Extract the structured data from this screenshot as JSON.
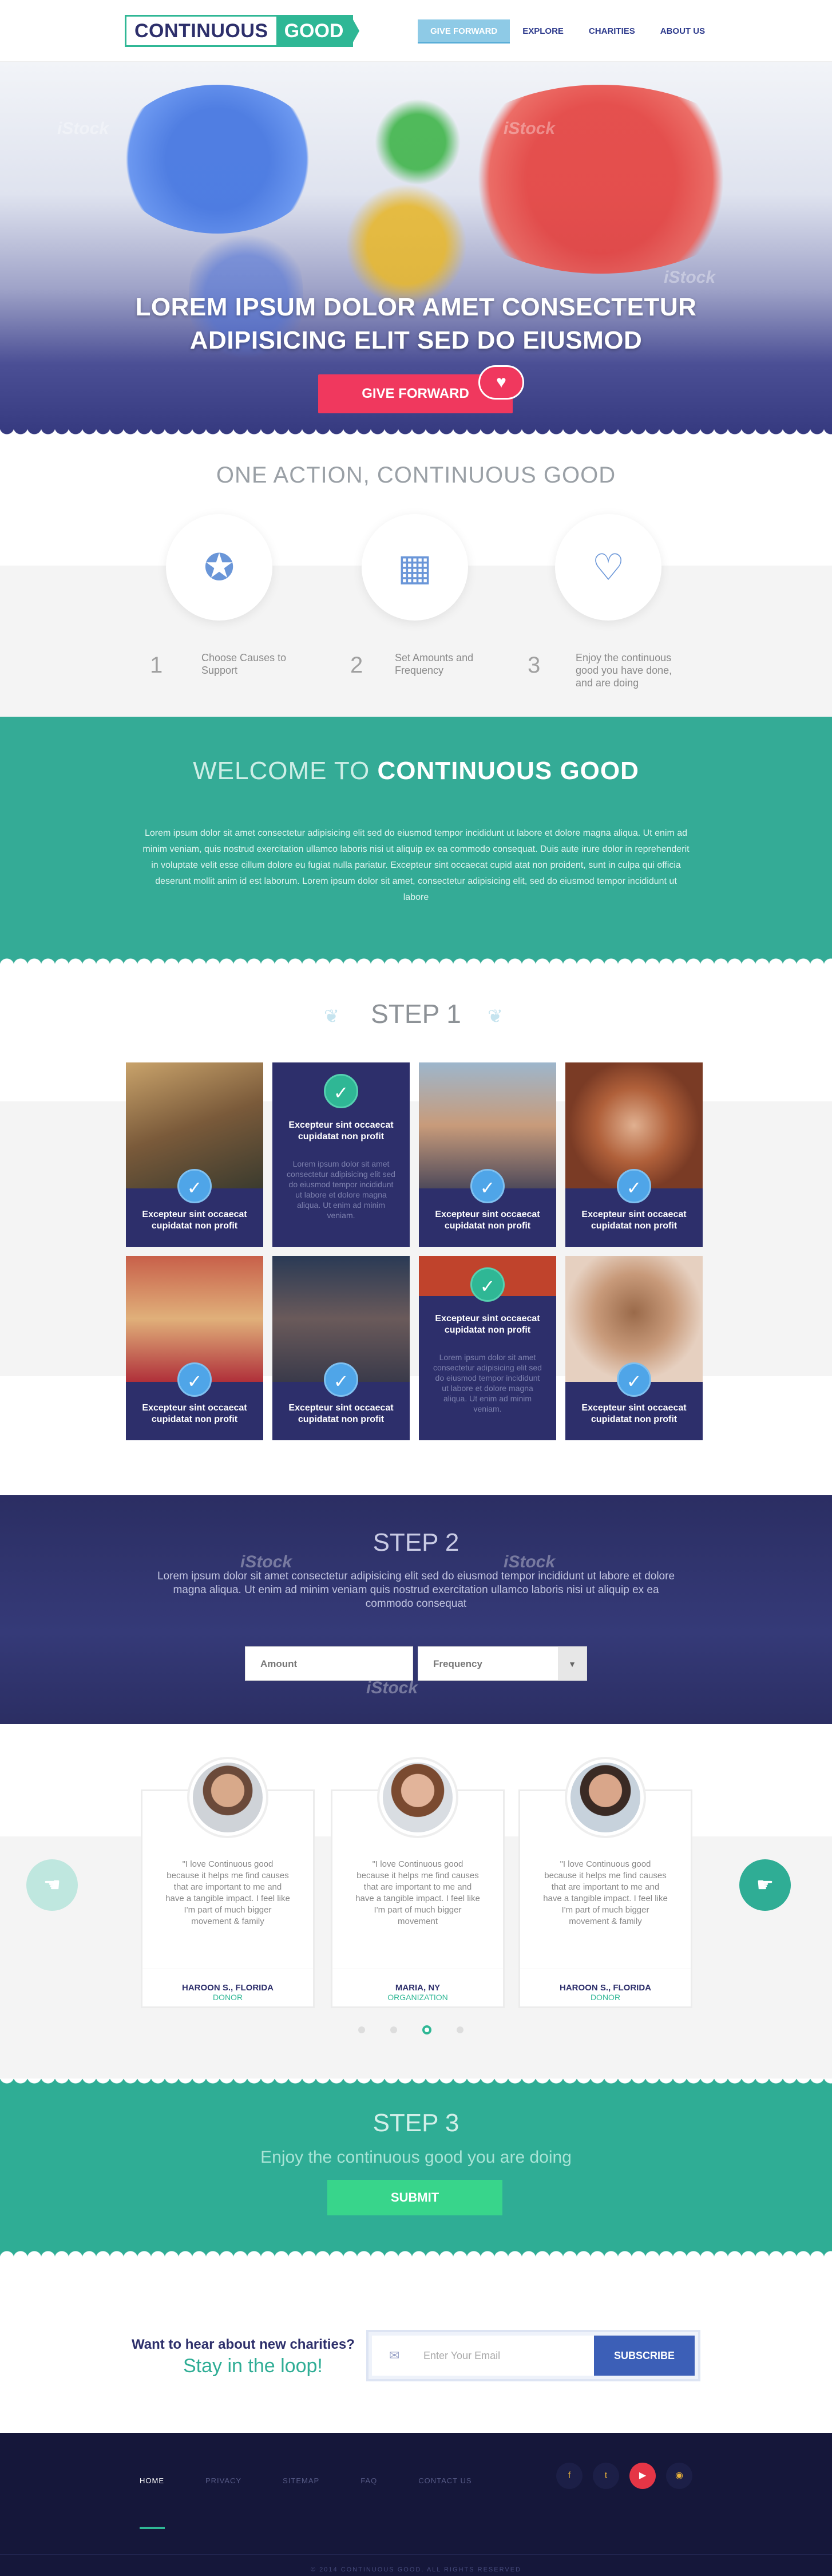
{
  "header": {
    "logo_left": "CONTINUOUS",
    "logo_right": "GOOD",
    "nav": [
      "GIVE FORWARD",
      "EXPLORE",
      "CHARITIES",
      "ABOUT US"
    ]
  },
  "hero": {
    "title_line1": "LOREM IPSUM DOLOR AMET CONSECTETUR",
    "title_line2": "ADIPISICING ELIT SED DO EIUSMOD",
    "cta": "GIVE FORWARD",
    "watermark": "iStock"
  },
  "one_action": {
    "title": "ONE ACTION, CONTINUOUS GOOD",
    "steps": [
      {
        "num": "1",
        "text": "Choose Causes to Support"
      },
      {
        "num": "2",
        "text": "Set Amounts and Frequency"
      },
      {
        "num": "3",
        "text": "Enjoy the continuous good you have done, and are doing"
      }
    ]
  },
  "welcome": {
    "title_light": "WELCOME TO",
    "title_bold": "CONTINUOUS GOOD",
    "body": "Lorem ipsum dolor sit amet consectetur adipisicing elit sed do eiusmod tempor incididunt ut labore et dolore magna aliqua. Ut enim ad minim veniam, quis nostrud exercitation ullamco laboris nisi ut aliquip ex ea commodo consequat. Duis aute irure dolor in reprehenderit in voluptate velit esse cillum dolore eu fugiat nulla pariatur. Excepteur sint occaecat cupid atat non proident, sunt in culpa qui officia deserunt mollit anim id est laborum. Lorem ipsum dolor sit amet, consectetur adipisicing elit, sed do eiusmod tempor incididunt ut labore"
  },
  "step1": {
    "title": "STEP 1",
    "card_title": "Excepteur sint occaecat cupidatat non profit",
    "card_desc": "Lorem ipsum dolor sit amet consectetur adipisicing elit sed do eiusmod tempor incididunt ut labore et dolore magna aliqua. Ut enim ad minim veniam.",
    "card_desc2": "Lorem ipsum dolor sit amet consectetur adipisicing elit sed do eiusmod tempor incididunt ut labore et dolore magna aliqua. Ut enim ad minim veniam."
  },
  "step2": {
    "title": "STEP 2",
    "body": "Lorem ipsum dolor sit amet consectetur adipisicing elit sed do eiusmod tempor incididunt ut labore et dolore magna aliqua. Ut enim ad minim veniam quis nostrud exercitation ullamco laboris nisi ut aliquip ex ea commodo consequat",
    "amount_placeholder": "Amount",
    "frequency_label": "Frequency"
  },
  "testimonials": [
    {
      "quote": "\"I love Continuous good because it helps me find causes that are important to me and have a tangible impact. I feel like I'm part of much bigger movement & family",
      "name": "HAROON S., FLORIDA",
      "role": "DONOR"
    },
    {
      "quote": "\"I love Continuous good because it helps me find causes that are important to me and have a tangible impact. I feel like I'm part of much bigger movement",
      "name": "MARIA, NY",
      "role": "ORGANIZATION"
    },
    {
      "quote": "\"I love Continuous good because it helps me find causes that are important to me and have a tangible impact. I feel like I'm part of much bigger movement & family",
      "name": "HAROON S., FLORIDA",
      "role": "DONOR"
    }
  ],
  "step3": {
    "title": "STEP 3",
    "subtitle": "Enjoy the continuous good you are doing",
    "button": "SUBMIT"
  },
  "newsletter": {
    "line1": "Want to hear about new charities?",
    "line2": "Stay in the loop!",
    "placeholder": "Enter Your Email",
    "button": "SUBSCRIBE"
  },
  "footer": {
    "nav": [
      "HOME",
      "PRIVACY",
      "SITEMAP",
      "FAQ",
      "CONTACT US"
    ],
    "copyright": "© 2014 CONTINUOUS GOOD. ALL RIGHTS RESERVED"
  },
  "colors": {
    "teal": "#34ab96",
    "navy": "#2d2f6b",
    "pink": "#f0385e",
    "blue": "#4fa5e8"
  }
}
